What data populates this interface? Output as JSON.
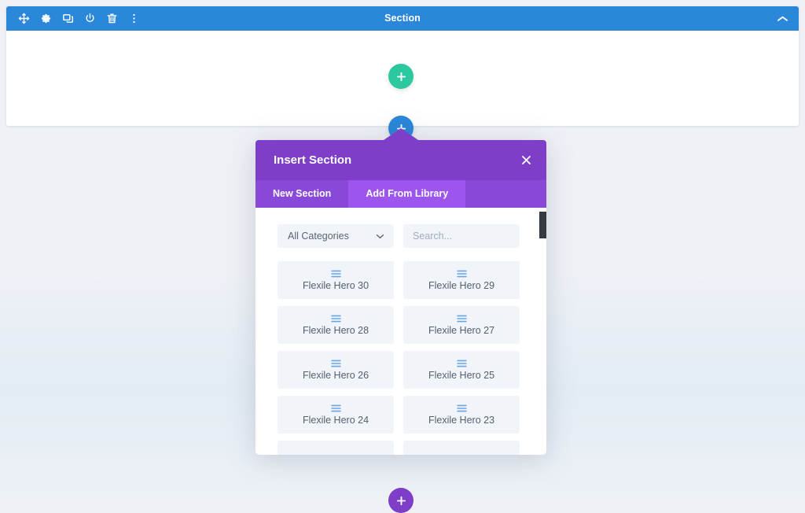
{
  "builder": {
    "section_toolbar": {
      "title": "Section",
      "icons": [
        {
          "name": "move-icon",
          "label": "Move Section"
        },
        {
          "name": "gear-icon",
          "label": "Section Settings"
        },
        {
          "name": "duplicate-icon",
          "label": "Duplicate Section"
        },
        {
          "name": "power-icon",
          "label": "Disable Section"
        },
        {
          "name": "trash-icon",
          "label": "Delete Section"
        },
        {
          "name": "more-options-icon",
          "label": "More Options"
        }
      ],
      "collapse_icon": "chevron-up-icon"
    },
    "add_row_button": {
      "icon": "plus-icon",
      "color": "#2cc9a0"
    },
    "add_section_button": {
      "icon": "plus-icon",
      "color": "#2b87da"
    },
    "add_section_button_bottom": {
      "icon": "plus-icon",
      "color": "#7e3ec8"
    }
  },
  "modal": {
    "title": "Insert Section",
    "close_icon": "close-icon",
    "header_color": "#7e3ec8",
    "tabs": [
      {
        "label": "New Section",
        "active": false
      },
      {
        "label": "Add From Library",
        "active": true
      }
    ],
    "filters": {
      "category_select": {
        "value": "All Categories",
        "icon": "chevron-down-icon"
      },
      "search": {
        "value": "",
        "placeholder": "Search..."
      }
    },
    "library_items": [
      {
        "label": "Flexile Hero 30",
        "icon": "layout-lines-icon"
      },
      {
        "label": "Flexile Hero 29",
        "icon": "layout-lines-icon"
      },
      {
        "label": "Flexile Hero 28",
        "icon": "layout-lines-icon"
      },
      {
        "label": "Flexile Hero 27",
        "icon": "layout-lines-icon"
      },
      {
        "label": "Flexile Hero 26",
        "icon": "layout-lines-icon"
      },
      {
        "label": "Flexile Hero 25",
        "icon": "layout-lines-icon"
      },
      {
        "label": "Flexile Hero 24",
        "icon": "layout-lines-icon"
      },
      {
        "label": "Flexile Hero 23",
        "icon": "layout-lines-icon"
      },
      {
        "label": "",
        "icon": "layout-lines-icon"
      },
      {
        "label": "",
        "icon": "layout-lines-icon"
      }
    ],
    "scrollbar": {
      "name": "vertical-scrollbar"
    }
  },
  "colors": {
    "toolbar_blue": "#2b87da",
    "modal_purple": "#7e3ec8",
    "tab_active_purple": "#9c56ee",
    "tab_bar_purple": "#8a48d8",
    "green": "#2cc9a0",
    "page_bg": "#eef1f6",
    "item_bg": "#f1f4f9"
  }
}
